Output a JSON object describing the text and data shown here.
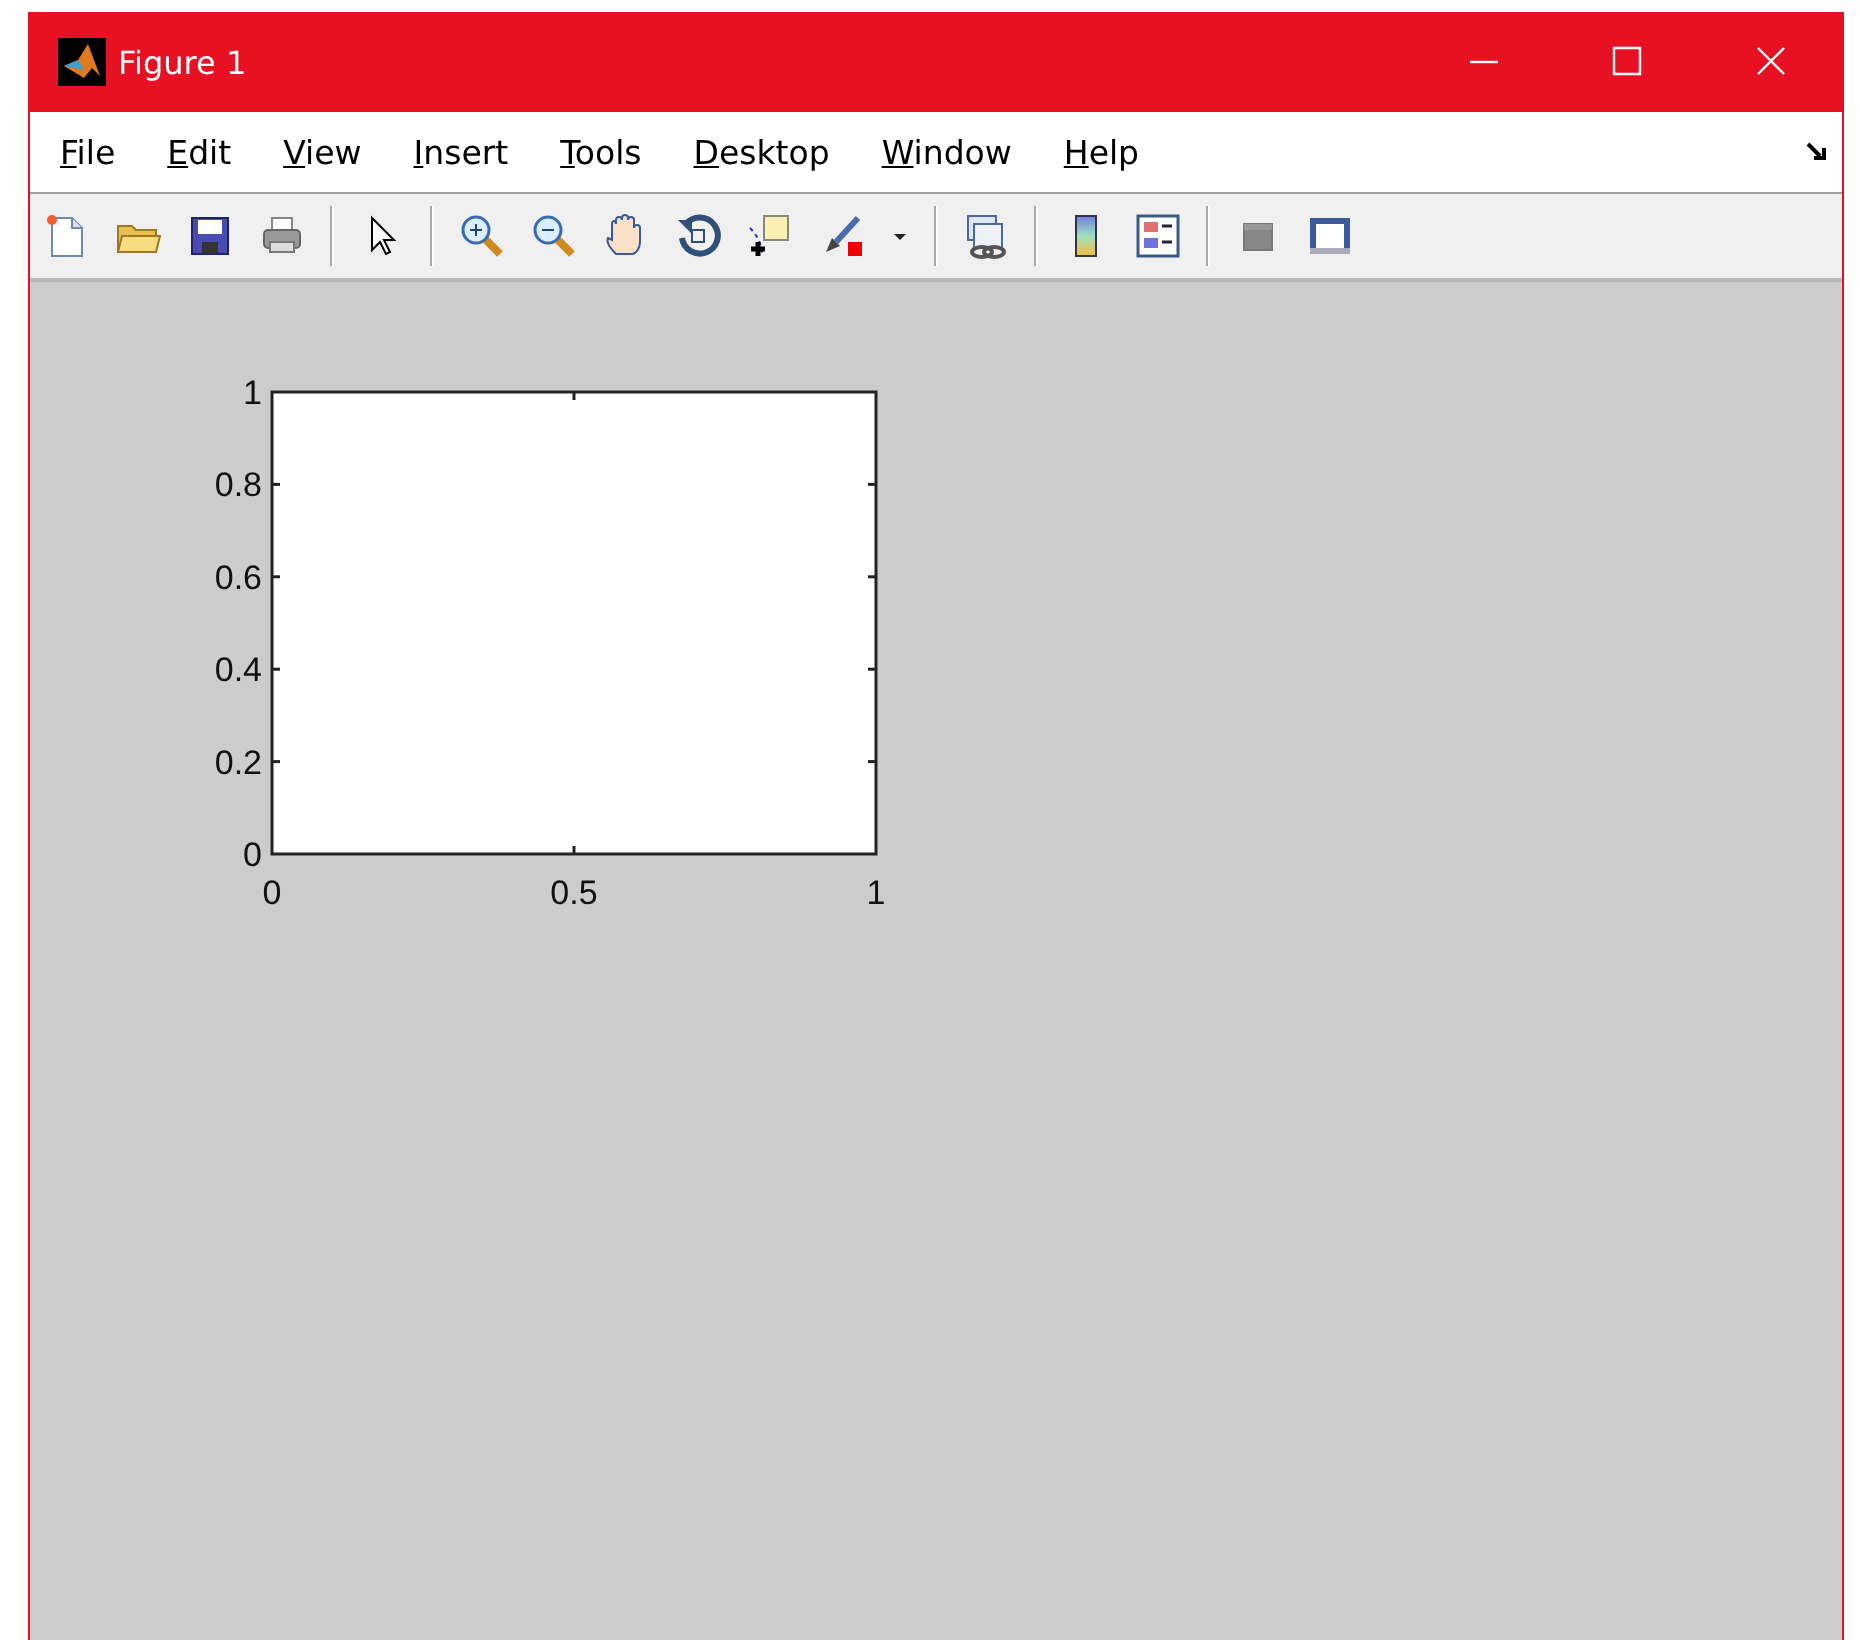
{
  "window": {
    "title": "Figure 1"
  },
  "menu": [
    {
      "label": "File"
    },
    {
      "label": "Edit"
    },
    {
      "label": "View"
    },
    {
      "label": "Insert"
    },
    {
      "label": "Tools"
    },
    {
      "label": "Desktop"
    },
    {
      "label": "Window"
    },
    {
      "label": "Help"
    }
  ],
  "toolbar": [
    {
      "kind": "new"
    },
    {
      "kind": "open"
    },
    {
      "kind": "save"
    },
    {
      "kind": "print"
    },
    {
      "kind": "separator"
    },
    {
      "kind": "pointer"
    },
    {
      "kind": "separator"
    },
    {
      "kind": "zoom-in"
    },
    {
      "kind": "zoom-out"
    },
    {
      "kind": "pan"
    },
    {
      "kind": "rotate"
    },
    {
      "kind": "datatip"
    },
    {
      "kind": "brush"
    },
    {
      "kind": "dropdown"
    },
    {
      "kind": "separator"
    },
    {
      "kind": "link"
    },
    {
      "kind": "separator"
    },
    {
      "kind": "colorbar"
    },
    {
      "kind": "legend"
    },
    {
      "kind": "separator"
    },
    {
      "kind": "hide-tools"
    },
    {
      "kind": "show-tools"
    }
  ],
  "axes": {
    "chart_data": {
      "type": "line",
      "xlim": [
        0,
        1
      ],
      "ylim": [
        0,
        1
      ],
      "xticks": [
        0,
        0.5,
        1
      ],
      "yticks": [
        0,
        0.2,
        0.4,
        0.6,
        0.8,
        1
      ]
    }
  }
}
